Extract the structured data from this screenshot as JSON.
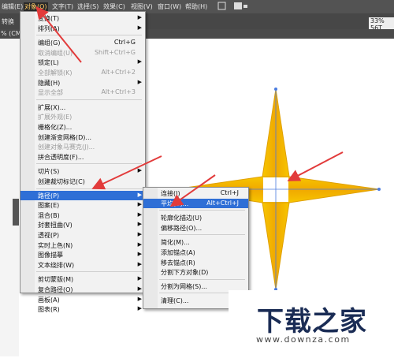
{
  "menubar": {
    "items": [
      "编辑(E)",
      "对象(O)",
      "文字(T)",
      "选择(S)",
      "效果(C)",
      "视图(V)",
      "窗口(W)",
      "帮助(H)"
    ]
  },
  "toolbar": {
    "label": "转换",
    "right_readout": "33% 56T"
  },
  "tab": {
    "label": "% (CMY"
  },
  "object_menu": {
    "items": [
      {
        "label": "变换(T)",
        "arrow": "▶"
      },
      {
        "label": "排列(A)",
        "arrow": "▶"
      },
      {
        "label": "编组(G)",
        "shortcut": "Ctrl+G"
      },
      {
        "label": "取消编组(U)",
        "shortcut": "Shift+Ctrl+G",
        "disabled": true
      },
      {
        "label": "锁定(L)",
        "arrow": "▶"
      },
      {
        "label": "全部解锁(K)",
        "shortcut": "Alt+Ctrl+2",
        "disabled": true
      },
      {
        "label": "隐藏(H)",
        "arrow": "▶"
      },
      {
        "label": "显示全部",
        "shortcut": "Alt+Ctrl+3",
        "disabled": true
      },
      {
        "label": "扩展(X)..."
      },
      {
        "label": "扩展外观(E)",
        "disabled": true
      },
      {
        "label": "栅格化(Z)..."
      },
      {
        "label": "创建渐变网格(D)..."
      },
      {
        "label": "创建对象马赛克(J)...",
        "disabled": true
      },
      {
        "label": "拼合透明度(F)..."
      },
      {
        "label": "切片(S)",
        "arrow": "▶"
      },
      {
        "label": "创建裁切标记(C)"
      },
      {
        "label": "路径(P)",
        "arrow": "▶",
        "highlight": true
      },
      {
        "label": "图案(E)",
        "arrow": "▶"
      },
      {
        "label": "混合(B)",
        "arrow": "▶"
      },
      {
        "label": "封套扭曲(V)",
        "arrow": "▶"
      },
      {
        "label": "透视(P)",
        "arrow": "▶"
      },
      {
        "label": "实时上色(N)",
        "arrow": "▶"
      },
      {
        "label": "图像描摹",
        "arrow": "▶"
      },
      {
        "label": "文本绕排(W)",
        "arrow": "▶"
      },
      {
        "label": "剪切蒙版(M)",
        "arrow": "▶"
      },
      {
        "label": "复合路径(O)",
        "arrow": "▶"
      },
      {
        "label": "画板(A)",
        "arrow": "▶"
      },
      {
        "label": "图表(R)",
        "arrow": "▶"
      }
    ]
  },
  "path_menu": {
    "items": [
      {
        "label": "连接(J)",
        "shortcut": "Ctrl+J"
      },
      {
        "label": "平均(V)...",
        "shortcut": "Alt+Ctrl+J",
        "highlight": true
      },
      {
        "label": "轮廓化描边(U)"
      },
      {
        "label": "偏移路径(O)..."
      },
      {
        "label": "简化(M)..."
      },
      {
        "label": "添加锚点(A)"
      },
      {
        "label": "移去锚点(R)"
      },
      {
        "label": "分割下方对象(D)"
      },
      {
        "label": "分割为网格(S)..."
      },
      {
        "label": "清理(C)..."
      }
    ]
  },
  "watermark": {
    "title": "下载之家",
    "url": "www.downza.com"
  },
  "colors": {
    "menubar": "#535353",
    "highlight": "#2f6fd6",
    "arrow": "#e23b3b",
    "star_fill": "#f5b400",
    "anchor": "#4a7be0"
  },
  "icons": [
    "chevron-right-icon",
    "red-arrow-annotation",
    "star-shape",
    "anchor-point-icon"
  ]
}
